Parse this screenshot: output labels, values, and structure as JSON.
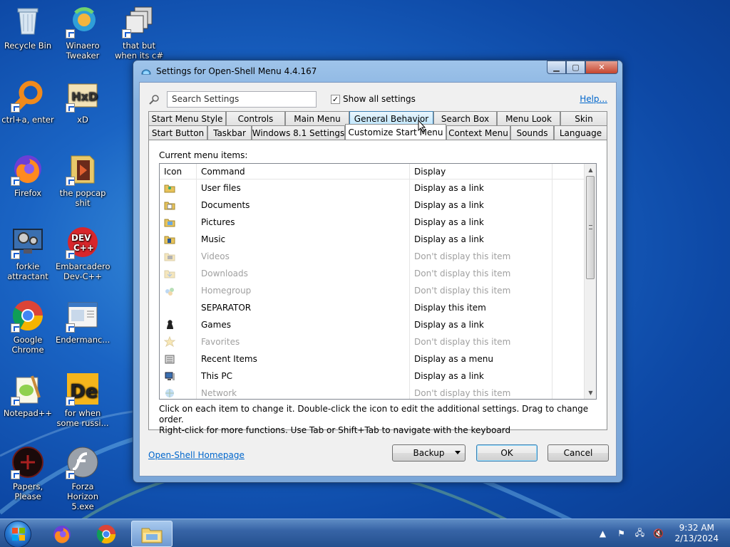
{
  "desktop": {
    "icons": [
      {
        "label": "Recycle Bin",
        "icon": "recycle-bin-icon"
      },
      {
        "label": "Winaero Tweaker",
        "icon": "winaero-icon"
      },
      {
        "label": "that but when its c#",
        "icon": "stack-icon"
      },
      {
        "label": "ctrl+a, enter",
        "icon": "orange-ring-icon"
      },
      {
        "label": "xD",
        "icon": "hxd-icon"
      },
      {
        "label": "Firefox",
        "icon": "firefox-icon"
      },
      {
        "label": "the popcap shit",
        "icon": "folder-icon"
      },
      {
        "label": "forkie attractant",
        "icon": "monitor-gear-icon"
      },
      {
        "label": "Embarcadero Dev-C++",
        "icon": "devcpp-icon"
      },
      {
        "label": "Google Chrome",
        "icon": "chrome-icon"
      },
      {
        "label": "Endermanc...",
        "icon": "window-icon"
      },
      {
        "label": "Notepad++",
        "icon": "notepadpp-icon"
      },
      {
        "label": "for when some russi...",
        "icon": "de-icon"
      },
      {
        "label": "Papers, Please",
        "icon": "papers-please-icon"
      },
      {
        "label": "Forza Horizon 5.exe",
        "icon": "flash-icon"
      }
    ]
  },
  "window": {
    "title": "Settings for Open-Shell Menu 4.4.167",
    "search": {
      "value": "Search Settings"
    },
    "show_all": {
      "label": "Show all settings",
      "checked": true
    },
    "help_link": "Help...",
    "tabs_row1": [
      "Start Menu Style",
      "Controls",
      "Main Menu",
      "General Behavior",
      "Search Box",
      "Menu Look",
      "Skin"
    ],
    "tabs_row2": [
      "Start Button",
      "Taskbar",
      "Windows 8.1 Settings",
      "Customize Start Menu",
      "Context Menu",
      "Sounds",
      "Language"
    ],
    "selected_tab": "Customize Start Menu",
    "hovered_tab": "General Behavior",
    "panel_label": "Current menu items:",
    "columns": [
      "Icon",
      "Command",
      "Display"
    ],
    "rows": [
      {
        "command": "User files",
        "display": "Display as a link",
        "enabled": true,
        "icon": "user-files-icon"
      },
      {
        "command": "Documents",
        "display": "Display as a link",
        "enabled": true,
        "icon": "documents-icon"
      },
      {
        "command": "Pictures",
        "display": "Display as a link",
        "enabled": true,
        "icon": "pictures-icon"
      },
      {
        "command": "Music",
        "display": "Display as a link",
        "enabled": true,
        "icon": "music-icon"
      },
      {
        "command": "Videos",
        "display": "Don't display this item",
        "enabled": false,
        "icon": "videos-icon"
      },
      {
        "command": "Downloads",
        "display": "Don't display this item",
        "enabled": false,
        "icon": "downloads-icon"
      },
      {
        "command": "Homegroup",
        "display": "Don't display this item",
        "enabled": false,
        "icon": "homegroup-icon"
      },
      {
        "command": "SEPARATOR",
        "display": "Display this item",
        "enabled": true,
        "icon": ""
      },
      {
        "command": "Games",
        "display": "Display as a link",
        "enabled": true,
        "icon": "games-icon"
      },
      {
        "command": "Favorites",
        "display": "Don't display this item",
        "enabled": false,
        "icon": "favorites-icon"
      },
      {
        "command": "Recent Items",
        "display": "Display as a menu",
        "enabled": true,
        "icon": "recent-items-icon"
      },
      {
        "command": "This PC",
        "display": "Display as a link",
        "enabled": true,
        "icon": "this-pc-icon"
      },
      {
        "command": "Network",
        "display": "Don't display this item",
        "enabled": false,
        "icon": "network-icon"
      }
    ],
    "help_line1": "Click on each item to change it. Double-click the icon to edit the additional settings. Drag to change order.",
    "help_line2": "Right-click for more functions. Use Tab or Shift+Tab to navigate with the keyboard",
    "homepage_link": "Open-Shell Homepage",
    "buttons": {
      "backup": "Backup",
      "ok": "OK",
      "cancel": "Cancel"
    }
  },
  "taskbar": {
    "apps": [
      "firefox-icon",
      "chrome-icon",
      "file-explorer-icon"
    ],
    "clock_time": "9:32 AM",
    "clock_date": "2/13/2024"
  },
  "colors": {
    "link": "#0066cc",
    "disabled_text": "#a0a0a0",
    "desktop": "#1a64c4"
  }
}
